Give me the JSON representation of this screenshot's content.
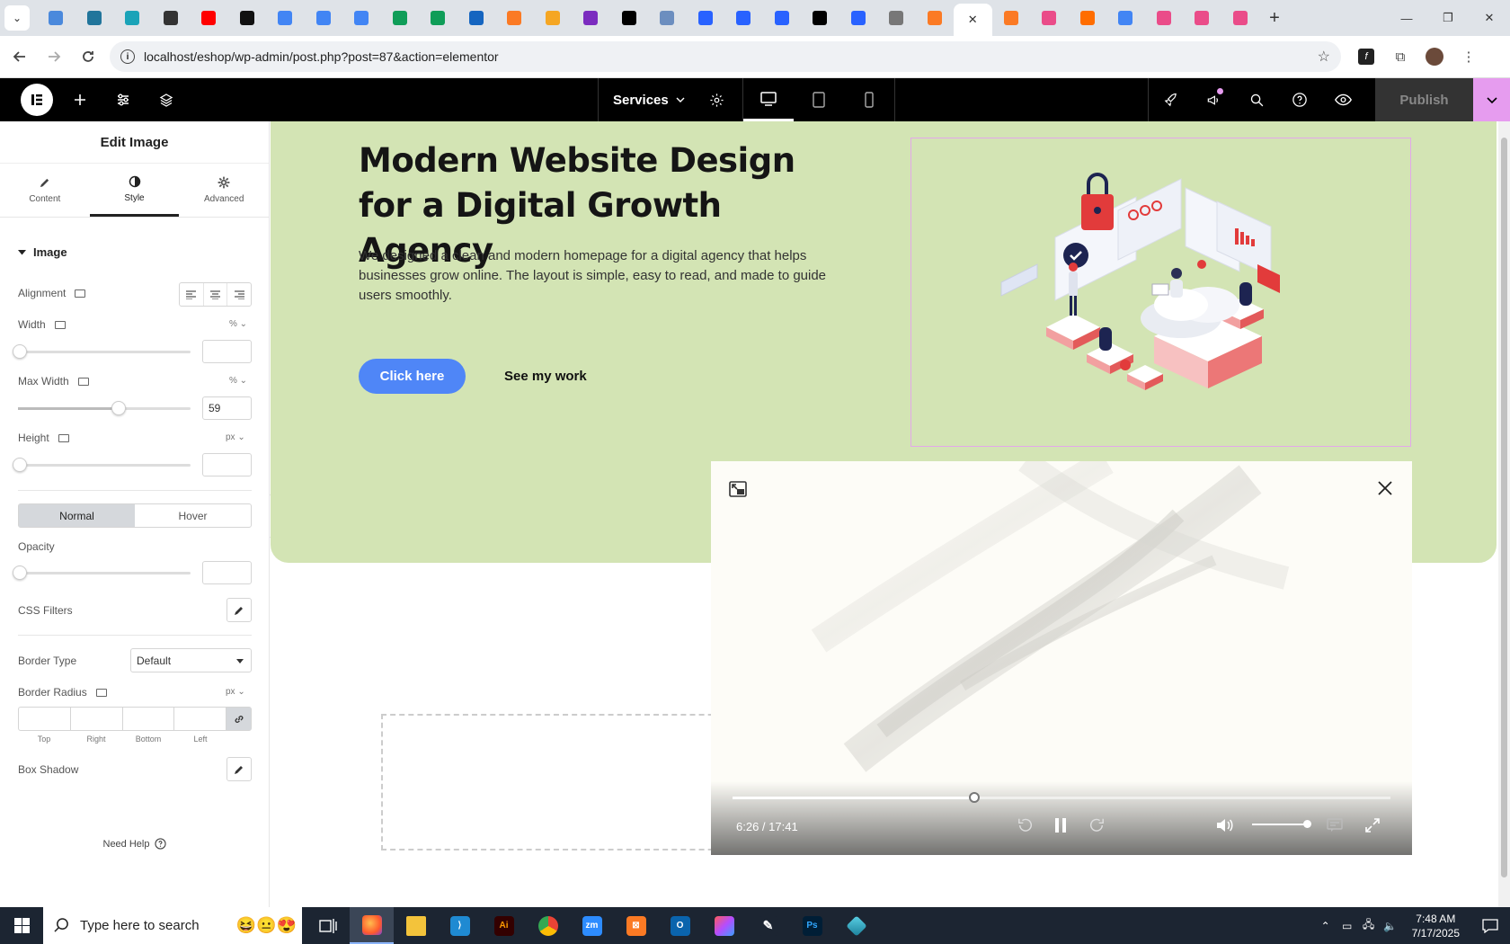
{
  "browser": {
    "url": "localhost/eshop/wp-admin/post.php?post=87&action=elementor",
    "tabs": [
      {
        "icon": "app-icon",
        "color": "#4a89dc",
        "label": ""
      },
      {
        "icon": "wordpress-icon",
        "color": "#21759b",
        "label": ""
      },
      {
        "icon": "app-icon",
        "color": "#1aa3b8",
        "label": ""
      },
      {
        "icon": "openai-icon",
        "color": "#333333",
        "label": ""
      },
      {
        "icon": "youtube-icon",
        "color": "#ff0000",
        "label": ""
      },
      {
        "icon": "bolt-icon",
        "color": "#111111",
        "label": ""
      },
      {
        "icon": "docs-icon",
        "color": "#4285f4",
        "label": ""
      },
      {
        "icon": "docs-icon",
        "color": "#4285f4",
        "label": ""
      },
      {
        "icon": "docs-icon",
        "color": "#4285f4",
        "label": ""
      },
      {
        "icon": "sheets-icon",
        "color": "#0f9d58",
        "label": ""
      },
      {
        "icon": "sheets-icon",
        "color": "#0f9d58",
        "label": ""
      },
      {
        "icon": "app-icon",
        "color": "#1565c0",
        "label": ""
      },
      {
        "icon": "xampp-icon",
        "color": "#fb7a24",
        "label": ""
      },
      {
        "icon": "app-icon",
        "color": "#f5a623",
        "label": ""
      },
      {
        "icon": "code-icon",
        "color": "#7b2cbf",
        "label": ""
      },
      {
        "icon": "app-icon",
        "color": "#000000",
        "label": ""
      },
      {
        "icon": "app-icon",
        "color": "#6c8ebf",
        "label": ""
      },
      {
        "icon": "forms-icon",
        "color": "#2962ff",
        "label": ""
      },
      {
        "icon": "forms-icon",
        "color": "#2962ff",
        "label": ""
      },
      {
        "icon": "forms-icon",
        "color": "#2962ff",
        "label": ""
      },
      {
        "icon": "app-icon",
        "color": "#000000",
        "label": ""
      },
      {
        "icon": "forms-icon",
        "color": "#2962ff",
        "label": ""
      },
      {
        "icon": "globe-icon",
        "color": "#777777",
        "label": ""
      },
      {
        "icon": "xampp-icon",
        "color": "#fb7a24",
        "label": ""
      },
      {
        "icon": "close-icon",
        "color": "#333333",
        "label": "✕"
      },
      {
        "icon": "xampp-icon",
        "color": "#fb7a24",
        "label": ""
      },
      {
        "icon": "dribbble-icon",
        "color": "#ea4c89",
        "label": ""
      },
      {
        "icon": "app-icon",
        "color": "#ff6d00",
        "label": ""
      },
      {
        "icon": "google-icon",
        "color": "#4285f4",
        "label": ""
      },
      {
        "icon": "dribbble-icon",
        "color": "#ea4c89",
        "label": ""
      },
      {
        "icon": "dribbble-icon",
        "color": "#ea4c89",
        "label": ""
      },
      {
        "icon": "dribbble-icon",
        "color": "#ea4c89",
        "label": ""
      }
    ],
    "new_tab": "+"
  },
  "elementor": {
    "page_name": "Services",
    "publish_label": "Publish",
    "panel": {
      "title": "Edit Image",
      "tabs": {
        "content": "Content",
        "style": "Style",
        "advanced": "Advanced"
      },
      "section": "Image",
      "alignment_label": "Alignment",
      "width_label": "Width",
      "width_unit": "%",
      "width_value": "",
      "max_width_label": "Max Width",
      "max_width_unit": "%",
      "max_width_value": "59",
      "height_label": "Height",
      "height_unit": "px",
      "height_value": "",
      "normal_label": "Normal",
      "hover_label": "Hover",
      "opacity_label": "Opacity",
      "css_filters_label": "CSS Filters",
      "border_type_label": "Border Type",
      "border_type_value": "Default",
      "border_radius_label": "Border Radius",
      "border_radius_unit": "px",
      "radius_labels": {
        "top": "Top",
        "right": "Right",
        "bottom": "Bottom",
        "left": "Left"
      },
      "box_shadow_label": "Box Shadow",
      "need_help": "Need Help"
    }
  },
  "hero": {
    "heading": "Modern Website Design for a Digital Growth Agency",
    "body": "We designed a clean and modern homepage for a digital agency that helps businesses grow online. The layout is simple, easy to read, and made to guide users smoothly.",
    "primary_button": "Click here",
    "secondary_link": "See my work",
    "bg_color": "#d3e4b4",
    "button_color": "#4f86f7"
  },
  "video": {
    "time": "6:26 / 17:41",
    "progress": 0.368,
    "volume": 0.95
  },
  "taskbar": {
    "search_placeholder": "Type here to search",
    "time": "7:48 AM",
    "date": "7/17/2025"
  }
}
